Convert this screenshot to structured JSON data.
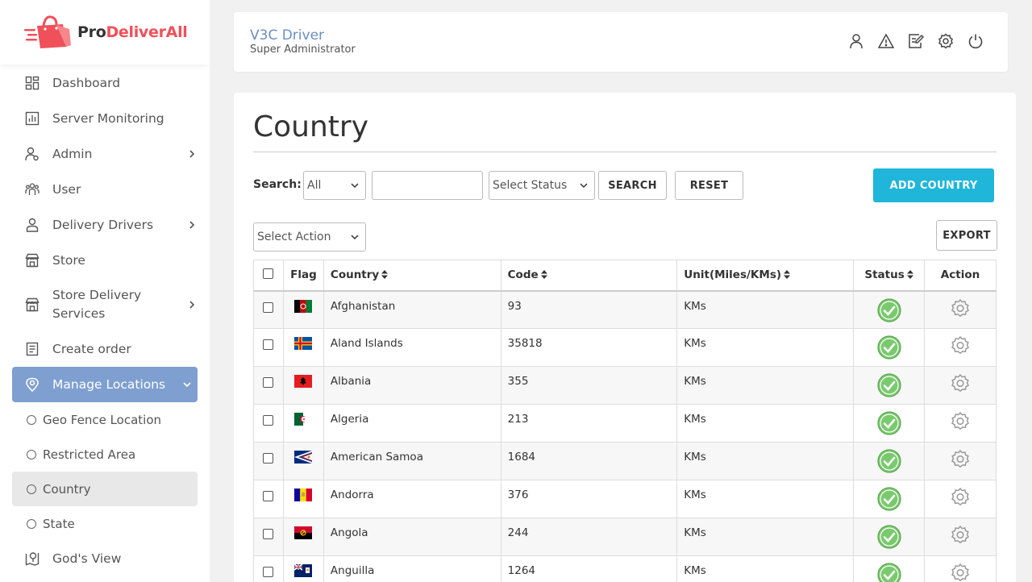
{
  "brand": {
    "pro": "Pro",
    "rest": "DeliverAll"
  },
  "sidebar": {
    "items": [
      {
        "label": "Dashboard",
        "icon": "dashboard-icon"
      },
      {
        "label": "Server Monitoring",
        "icon": "chart-icon"
      },
      {
        "label": "Admin",
        "icon": "admin-icon",
        "has_children": true
      },
      {
        "label": "User",
        "icon": "users-icon"
      },
      {
        "label": "Delivery Drivers",
        "icon": "driver-icon",
        "has_children": true
      },
      {
        "label": "Store",
        "icon": "store-icon"
      },
      {
        "label": "Store Delivery Services",
        "icon": "store-icon",
        "has_children": true
      },
      {
        "label": "Create order",
        "icon": "order-icon"
      },
      {
        "label": "Manage Locations",
        "icon": "location-pin-icon",
        "expanded": true
      }
    ],
    "sub_items": [
      {
        "label": "Geo Fence Location"
      },
      {
        "label": "Restricted Area"
      },
      {
        "label": "Country",
        "current": true
      },
      {
        "label": "State"
      }
    ],
    "bottom_item": {
      "label": "God's View",
      "icon": "map-icon"
    }
  },
  "header": {
    "name": "V3C Driver",
    "role": "Super Administrator",
    "icons": [
      "profile-icon",
      "alert-icon",
      "edit-icon",
      "settings-icon",
      "power-icon"
    ]
  },
  "page": {
    "title": "Country",
    "search_label": "Search:",
    "search_scope": "All",
    "search_value": "",
    "status_select": "Select Status",
    "search_button": "SEARCH",
    "reset_button": "RESET",
    "add_button": "ADD COUNTRY",
    "action_select": "Select Action",
    "export_button": "EXPORT"
  },
  "table": {
    "headers": {
      "flag": "Flag",
      "country": "Country",
      "code": "Code",
      "unit": "Unit(Miles/KMs)",
      "status": "Status",
      "action": "Action"
    },
    "rows": [
      {
        "country": "Afghanistan",
        "code": "93",
        "unit": "KMs"
      },
      {
        "country": "Aland Islands",
        "code": "35818",
        "unit": "KMs"
      },
      {
        "country": "Albania",
        "code": "355",
        "unit": "KMs"
      },
      {
        "country": "Algeria",
        "code": "213",
        "unit": "KMs"
      },
      {
        "country": "American Samoa",
        "code": "1684",
        "unit": "KMs"
      },
      {
        "country": "Andorra",
        "code": "376",
        "unit": "KMs"
      },
      {
        "country": "Angola",
        "code": "244",
        "unit": "KMs"
      },
      {
        "country": "Anguilla",
        "code": "1264",
        "unit": "KMs"
      }
    ]
  },
  "colors": {
    "accent": "#1fb6d9",
    "active_nav": "#7e9fcf",
    "brand_red": "#f0505a",
    "status_green": "#7bc96f"
  }
}
